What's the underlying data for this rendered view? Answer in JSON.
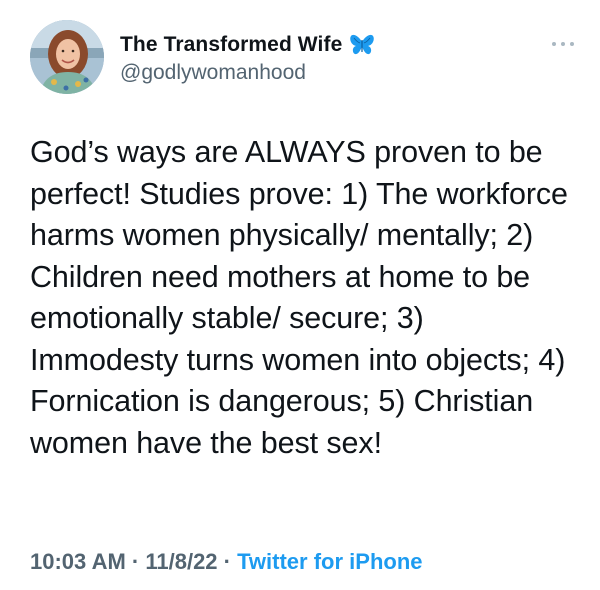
{
  "tweet": {
    "display_name": "The Transformed Wife",
    "handle": "@godlywomanhood",
    "verified_emoji": "butterfly-icon",
    "text": "God’s ways are ALWAYS proven to be perfect! Studies prove: 1) The workforce harms women physically/ mentally; 2) Children need mothers at home to be emotionally stable/ secure; 3) Immodesty turns women into objects; 4) Fornication is dangerous; 5) Christian women have the best sex!",
    "time": "10:03 AM",
    "date": "11/8/22",
    "separator": "·",
    "source": "Twitter for iPhone"
  },
  "colors": {
    "text_primary": "#0f1419",
    "text_secondary": "#536471",
    "link": "#1d9bf0",
    "butterfly": "#1d9bf0"
  }
}
